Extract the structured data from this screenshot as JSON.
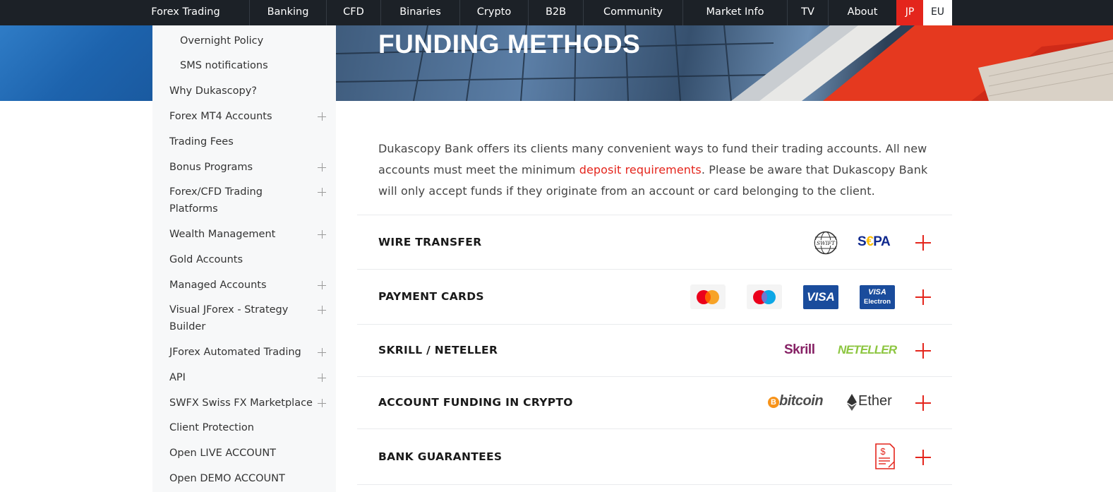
{
  "nav": {
    "items": [
      "Forex Trading",
      "Banking",
      "CFD",
      "Binaries",
      "Crypto",
      "B2B",
      "Community",
      "Market Info",
      "TV",
      "About"
    ],
    "lang_jp": "JP",
    "lang_eu": "EU"
  },
  "banner": {
    "title": "FUNDING METHODS"
  },
  "sidebar": {
    "items": [
      {
        "label": "Overnight Policy"
      },
      {
        "label": "SMS notifications"
      },
      {
        "label": "Why Dukascopy?"
      },
      {
        "label": "Forex MT4 Accounts"
      },
      {
        "label": "Trading Fees"
      },
      {
        "label": "Bonus Programs"
      },
      {
        "label": "Forex/CFD Trading Platforms"
      },
      {
        "label": "Wealth Management"
      },
      {
        "label": "Gold Accounts"
      },
      {
        "label": "Managed Accounts"
      },
      {
        "label": "Visual JForex - Strategy Builder"
      },
      {
        "label": "JForex Automated Trading"
      },
      {
        "label": "API"
      },
      {
        "label": "SWFX Swiss FX Marketplace"
      },
      {
        "label": "Client Protection"
      },
      {
        "label": "Open LIVE ACCOUNT"
      },
      {
        "label": "Open DEMO ACCOUNT"
      }
    ]
  },
  "intro": {
    "before": "Dukascopy Bank offers its clients many convenient ways to fund their trading accounts. All new accounts must meet the minimum ",
    "link": "deposit requirements",
    "after": ". Please be aware that Dukascopy Bank will only accept funds if they originate from an account or card belonging to the client."
  },
  "methods": [
    {
      "label": "WIRE TRANSFER"
    },
    {
      "label": "PAYMENT CARDS"
    },
    {
      "label": "SKRILL / NETELLER"
    },
    {
      "label": "ACCOUNT FUNDING IN CRYPTO"
    },
    {
      "label": "BANK GUARANTEES"
    }
  ],
  "logos": {
    "swift": "SWIFT",
    "sepa_s": "S",
    "sepa_euro": "€",
    "sepa_pa": "PA",
    "visa": "VISA",
    "visa_electron_top": "VISA",
    "visa_electron_bottom": "Electron",
    "skrill": "Skrill",
    "neteller": "NETELLER",
    "bitcoin": "bitcoin",
    "bitcoin_symbol": "B",
    "ether": "Ether"
  },
  "colors": {
    "accent": "#e4251c",
    "nav_bg": "#1c2127",
    "sidebar_bg": "#f7f8f9",
    "sepa_blue": "#10298e",
    "sepa_gold": "#ffbe00",
    "visa_blue": "#1a4c9c",
    "skrill_purple": "#862165",
    "neteller_green": "#8dc641",
    "bitcoin_orange": "#f7931a"
  },
  "icons": [
    "plus-icon",
    "swift-logo",
    "sepa-logo",
    "mastercard-logo",
    "maestro-logo",
    "visa-logo",
    "visa-electron-logo",
    "skrill-logo",
    "neteller-logo",
    "bitcoin-logo",
    "ether-logo",
    "guarantee-document-icon"
  ]
}
